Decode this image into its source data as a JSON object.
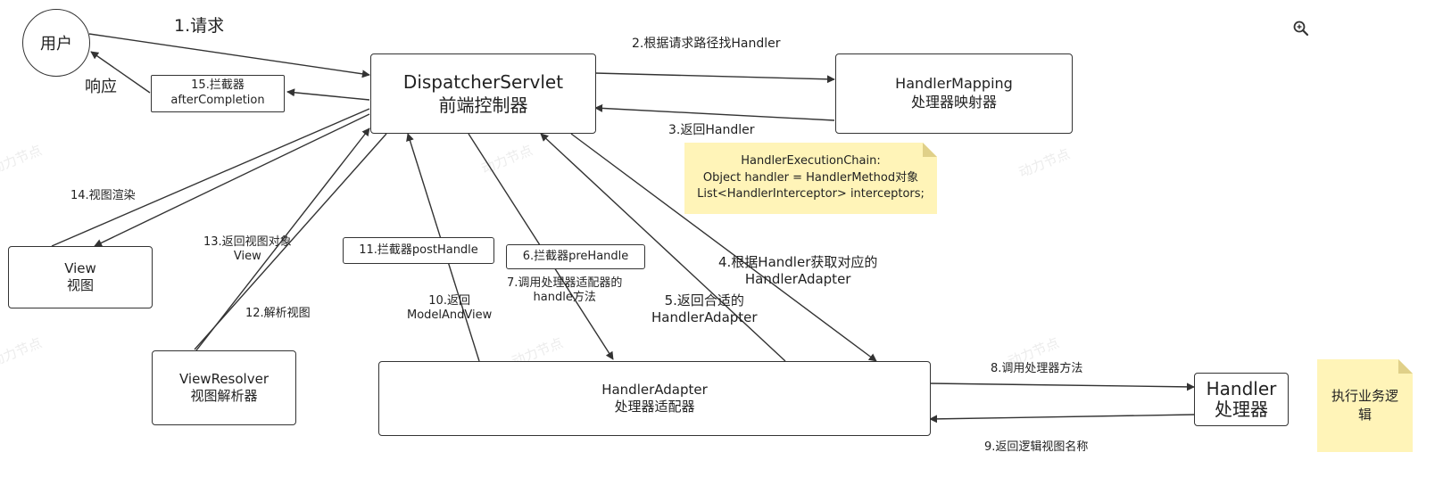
{
  "nodes": {
    "user": "用户",
    "dispatcher": {
      "line1": "DispatcherServlet",
      "line2": "前端控制器"
    },
    "handler_mapping": {
      "line1": "HandlerMapping",
      "line2": "处理器映射器"
    },
    "interceptor_after": {
      "line1": "15.拦截器",
      "line2": "afterCompletion"
    },
    "view": {
      "line1": "View",
      "line2": "视图"
    },
    "view_resolver": {
      "line1": "ViewResolver",
      "line2": "视图解析器"
    },
    "interceptor_post": "11.拦截器postHandle",
    "interceptor_pre": "6.拦截器preHandle",
    "handler_adapter": {
      "line1": "HandlerAdapter",
      "line2": "处理器适配器"
    },
    "handler": {
      "line1": "Handler",
      "line2": "处理器"
    }
  },
  "notes": {
    "execution_chain": {
      "line1": "HandlerExecutionChain:",
      "line2": "Object handler = HandlerMethod对象",
      "line3": "List<HandlerInterceptor> interceptors;"
    },
    "business_logic": {
      "line1": "执行业务逻",
      "line2": "辑"
    }
  },
  "edges": {
    "s1": "1.请求",
    "response": "响应",
    "s2": "2.根据请求路径找Handler",
    "s3": "3.返回Handler",
    "s4": {
      "line1": "4.根据Handler获取对应的",
      "line2": "HandlerAdapter"
    },
    "s5": {
      "line1": "5.返回合适的",
      "line2": "HandlerAdapter"
    },
    "s7": {
      "line1": "7.调用处理器适配器的",
      "line2": "handle方法"
    },
    "s8": "8.调用处理器方法",
    "s9": "9.返回逻辑视图名称",
    "s10": {
      "line1": "10.返回",
      "line2": "ModelAndView"
    },
    "s12": "12.解析视图",
    "s13": {
      "line1": "13.返回视图对象",
      "line2": "View"
    },
    "s14": "14.视图渲染"
  },
  "watermark": "动力节点",
  "colors": {
    "line": "#333333",
    "note": "#fff4b8",
    "note_fold": "#e0d089"
  },
  "toolbar": {
    "zoom_icon": "zoom-in-icon"
  }
}
